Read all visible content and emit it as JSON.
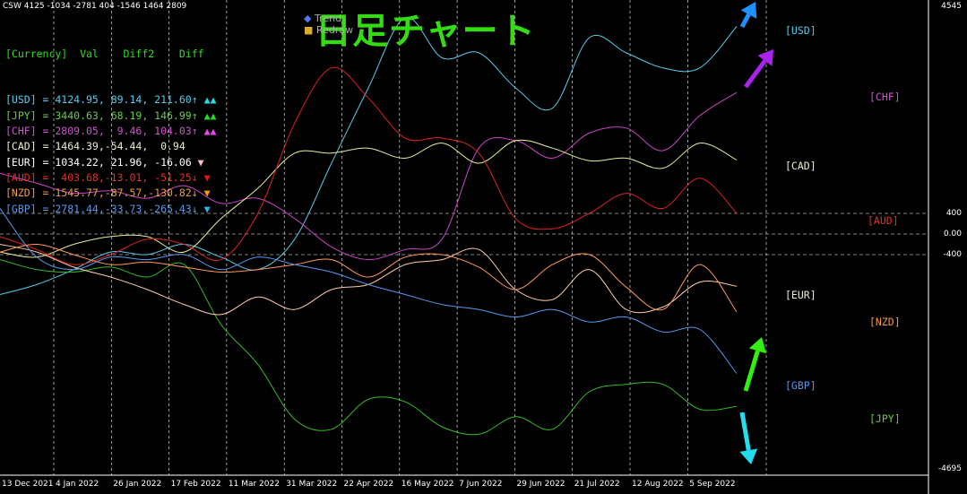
{
  "header": {
    "indicator_readout": "CSW 4125 -1034 -2781 404 -1546 1464 2809"
  },
  "title": {
    "text": "日足チャート",
    "legend_item_1": "Trend",
    "legend_item_2": "Redraw"
  },
  "table": {
    "header_line": "[Currency]  Val    Diff2    Diff",
    "rows": [
      {
        "code": "USD",
        "line": "[USD] = 4124.95, 89.14, 211.60↑",
        "color": "#55ccee",
        "marker": "up",
        "marker_color": "#22dddd"
      },
      {
        "code": "JPY",
        "line": "[JPY] = 3440.63, 68.19, 146.99↑",
        "color": "#66cc44",
        "marker": "up",
        "marker_color": "#22dd22"
      },
      {
        "code": "CHF",
        "line": "[CHF] = 2809.05,  9.46, 104.03↑",
        "color": "#cc55cc",
        "marker": "up",
        "marker_color": "#ee44ee"
      },
      {
        "code": "CAD",
        "line": "[CAD] = 1464.39,-54.44,  0.94",
        "color": "#eeeecc",
        "marker": "none",
        "marker_color": ""
      },
      {
        "code": "EUR",
        "line": "[EUR] = 1034.22, 21.96, -16.06",
        "color": "#ffffff",
        "marker": "down",
        "marker_color": "#ffbbcc"
      },
      {
        "code": "AUD",
        "line": "[AUD] =  403.68,-13.01, -51.25↓",
        "color": "#dd3322",
        "marker": "down",
        "marker_color": "#ee1111"
      },
      {
        "code": "NZD",
        "line": "[NZD] = 1545.77,-87.57,-130.82↓",
        "color": "#ee9944",
        "marker": "down",
        "marker_color": "#ff9900"
      },
      {
        "code": "GBP",
        "line": "[GBP] = 2781.44,-33.73,-265.43↓",
        "color": "#5599ee",
        "marker": "down",
        "marker_color": "#22bbee"
      }
    ]
  },
  "axis": {
    "y_ticks": [
      {
        "label": "4545",
        "value": 4545
      },
      {
        "label": "400",
        "value": 400
      },
      {
        "label": "0.00",
        "value": 0
      },
      {
        "label": "-400",
        "value": -400
      },
      {
        "label": "-4695",
        "value": -4695
      }
    ],
    "x_ticks": [
      "13 Dec 2021",
      "4 Jan 2022",
      "26 Jan 2022",
      "17 Feb 2022",
      "11 Mar 2022",
      "31 Mar 2022",
      "22 Apr 2022",
      "16 May 2022",
      "7 Jun 2022",
      "29 Jun 2022",
      "21 Jul 2022",
      "12 Aug 2022",
      "5 Sep 2022"
    ]
  },
  "currency_labels": [
    {
      "text": "[USD]",
      "color": "#55ccee"
    },
    {
      "text": "[CHF]",
      "color": "#cc55cc"
    },
    {
      "text": "[CAD]",
      "color": "#eeeecc"
    },
    {
      "text": "[AUD]",
      "color": "#dd3322"
    },
    {
      "text": "[EUR]",
      "color": "#eeeecc"
    },
    {
      "text": "[NZD]",
      "color": "#ee9944"
    },
    {
      "text": "[GBP]",
      "color": "#5599ee"
    },
    {
      "text": "[JPY]",
      "color": "#66cc44"
    }
  ],
  "chart_data": {
    "type": "line",
    "title": "日足チャート",
    "ylim": [
      -4695,
      4545
    ],
    "series": [
      {
        "name": "USD",
        "color": "#55ccee",
        "values": [
          -1200,
          -1000,
          -700,
          -350,
          -400,
          -200,
          -450,
          -700,
          -100,
          1400,
          2900,
          4300,
          3500,
          3600,
          2900,
          2500,
          3900,
          3600,
          3300,
          3300,
          4125
        ]
      },
      {
        "name": "JPY",
        "color": "#33bb22",
        "values": [
          -500,
          -700,
          -750,
          -650,
          -850,
          -600,
          -1800,
          -2600,
          -3700,
          -3900,
          -3300,
          -3350,
          -3850,
          -4000,
          -3650,
          -3900,
          -3150,
          -3000,
          -3000,
          -3500,
          -3440
        ]
      },
      {
        "name": "CHF",
        "color": "#cc44cc",
        "values": [
          1200,
          1000,
          800,
          850,
          700,
          950,
          600,
          700,
          300,
          -250,
          -500,
          -300,
          -100,
          1700,
          1850,
          1500,
          2000,
          2100,
          1650,
          2350,
          2809
        ]
      },
      {
        "name": "CAD",
        "color": "#eeee99",
        "values": [
          -350,
          -450,
          -200,
          -50,
          -50,
          -350,
          300,
          900,
          1600,
          1600,
          1700,
          1500,
          1800,
          1400,
          1850,
          1700,
          1450,
          1500,
          1300,
          1800,
          1464
        ]
      },
      {
        "name": "EUR",
        "color": "#ffccaa",
        "values": [
          -200,
          -350,
          -650,
          -850,
          -1100,
          -1400,
          -1600,
          -1250,
          -1500,
          -1100,
          -1000,
          -600,
          -500,
          -300,
          -1100,
          -1300,
          -700,
          -1500,
          -1450,
          -950,
          -1034
        ]
      },
      {
        "name": "AUD",
        "color": "#dd2222",
        "values": [
          -50,
          -300,
          -600,
          -400,
          -100,
          -200,
          -500,
          400,
          2200,
          3300,
          2700,
          1900,
          1900,
          1600,
          300,
          100,
          400,
          800,
          500,
          1100,
          404
        ]
      },
      {
        "name": "NZD",
        "color": "#ff9955",
        "values": [
          -350,
          -200,
          -400,
          -600,
          -550,
          -650,
          -750,
          -700,
          -600,
          -500,
          -850,
          -450,
          -400,
          -650,
          -1100,
          -600,
          -400,
          -1050,
          -1500,
          -600,
          -1546
        ]
      },
      {
        "name": "GBP",
        "color": "#5599ee",
        "values": [
          500,
          -450,
          -700,
          -450,
          -500,
          -400,
          -700,
          -450,
          -600,
          -750,
          -1000,
          -1200,
          -1400,
          -1500,
          -1650,
          -1500,
          -1750,
          -1650,
          -1950,
          -1900,
          -2781
        ]
      }
    ]
  }
}
